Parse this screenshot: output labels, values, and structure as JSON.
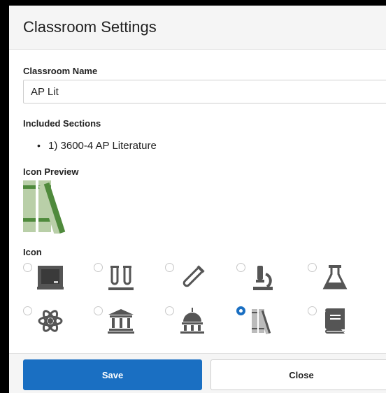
{
  "dialog": {
    "title": "Classroom Settings"
  },
  "form": {
    "classroom_name_label": "Classroom Name",
    "classroom_name_value": "AP Lit",
    "included_sections_label": "Included Sections",
    "sections": [
      "1) 3600-4 AP Literature"
    ],
    "icon_preview_label": "Icon Preview",
    "icon_label": "Icon"
  },
  "icons": [
    {
      "name": "chalkboard-icon",
      "selected": false
    },
    {
      "name": "test-tubes-icon",
      "selected": false
    },
    {
      "name": "test-tube-icon",
      "selected": false
    },
    {
      "name": "microscope-icon",
      "selected": false
    },
    {
      "name": "flask-icon",
      "selected": false
    },
    {
      "name": "atom-icon",
      "selected": false
    },
    {
      "name": "columns-building-icon",
      "selected": false
    },
    {
      "name": "capitol-dome-icon",
      "selected": false
    },
    {
      "name": "books-icon",
      "selected": true
    },
    {
      "name": "book-icon",
      "selected": false
    }
  ],
  "colors": {
    "primary": "#1a6fc2",
    "icon_gray": "#555555",
    "books_light_green": "#b9cfa8",
    "books_dark_green": "#4f8a3c"
  },
  "footer": {
    "save_label": "Save",
    "close_label": "Close"
  }
}
